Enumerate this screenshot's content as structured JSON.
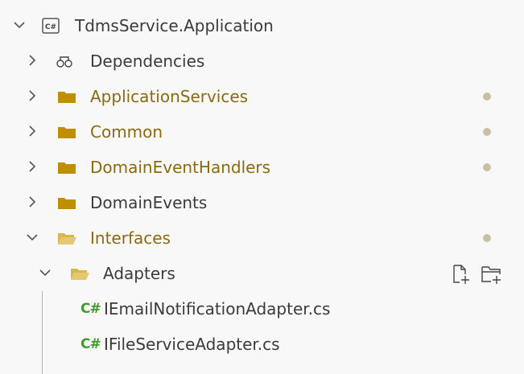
{
  "tree": {
    "root": {
      "label": "TdmsService.Application",
      "expanded": true,
      "icon": "csharp-project-icon"
    },
    "dependencies": {
      "label": "Dependencies",
      "expanded": false,
      "icon": "dependencies-icon"
    },
    "folders": [
      {
        "label": "ApplicationServices",
        "modified": true
      },
      {
        "label": "Common",
        "modified": true
      },
      {
        "label": "DomainEventHandlers",
        "modified": true
      },
      {
        "label": "DomainEvents",
        "modified": false
      }
    ],
    "interfaces": {
      "label": "Interfaces",
      "expanded": true,
      "modified": true
    },
    "adapters": {
      "label": "Adapters",
      "expanded": true,
      "actions": [
        "new-file-icon",
        "new-folder-icon"
      ]
    },
    "files": [
      {
        "badge": "C#",
        "label": "IEmailNotificationAdapter.cs"
      },
      {
        "badge": "C#",
        "label": "IFileServiceAdapter.cs"
      }
    ]
  },
  "colors": {
    "folder": "#bf8f00",
    "modified_text": "#8a6a10",
    "modified_dot": "#c9c0a3",
    "csharp_badge": "#3f9b2b",
    "background": "#f8f8f8"
  }
}
